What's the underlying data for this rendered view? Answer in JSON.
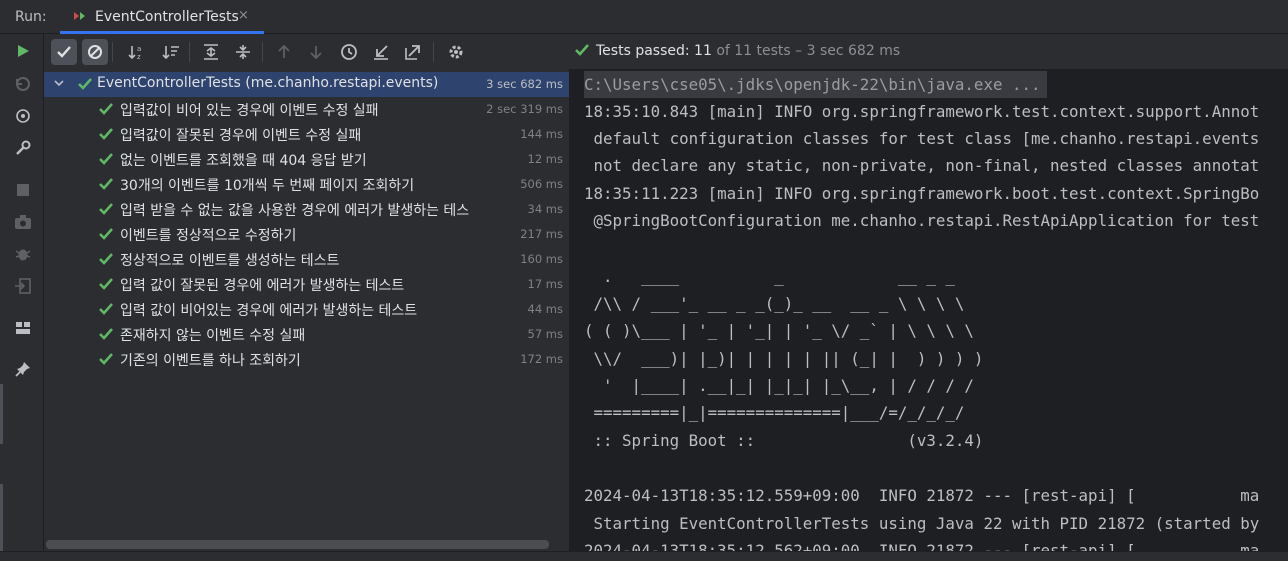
{
  "run_panel": {
    "label": "Run:",
    "tab_title": "EventControllerTests",
    "tab_close": "×"
  },
  "status": {
    "prefix": "Tests passed: ",
    "passed": "11",
    "suffix": " of 11 tests – 3 sec 682 ms"
  },
  "tree": {
    "root": {
      "name": "EventControllerTests (me.chanho.restapi.events)",
      "time": "3 sec 682 ms"
    },
    "tests": [
      {
        "name": "입력값이 비어 있는 경우에 이벤트 수정 실패",
        "time": "2 sec 319 ms"
      },
      {
        "name": "입력값이 잘못된 경우에 이벤트 수정 실패",
        "time": "144 ms"
      },
      {
        "name": "없는 이벤트를 조회했을 때 404 응답 받기",
        "time": "12 ms"
      },
      {
        "name": "30개의 이벤트를 10개씩 두 번째 페이지 조회하기",
        "time": "506 ms"
      },
      {
        "name": "입력 받을 수 없는 값을 사용한 경우에 에러가 발생하는 테스",
        "time": "34 ms"
      },
      {
        "name": "이벤트를 정상적으로 수정하기",
        "time": "217 ms"
      },
      {
        "name": "정상적으로 이벤트를 생성하는 테스트",
        "time": "160 ms"
      },
      {
        "name": "입력 값이 잘못된 경우에 에러가 발생하는 테스트",
        "time": "17 ms"
      },
      {
        "name": "입력 값이 비어있는 경우에 에러가 발생하는 테스트",
        "time": "44 ms"
      },
      {
        "name": "존재하지 않는 이벤트 수정 실패",
        "time": "57 ms"
      },
      {
        "name": "기존의 이벤트를 하나 조회하기",
        "time": "172 ms"
      }
    ]
  },
  "console": {
    "lines": [
      "C:\\Users\\cse05\\.jdks\\openjdk-22\\bin\\java.exe ...",
      "18:35:10.843 [main] INFO org.springframework.test.context.support.Annot",
      " default configuration classes for test class [me.chanho.restapi.events",
      " not declare any static, non-private, non-final, nested classes annotat",
      "18:35:11.223 [main] INFO org.springframework.boot.test.context.SpringBo",
      " @SpringBootConfiguration me.chanho.restapi.RestApiApplication for test",
      "",
      "  .   ____          _            __ _ _",
      " /\\\\ / ___'_ __ _ _(_)_ __  __ _ \\ \\ \\ \\",
      "( ( )\\___ | '_ | '_| | '_ \\/ _` | \\ \\ \\ \\",
      " \\\\/  ___)| |_)| | | | | || (_| |  ) ) ) )",
      "  '  |____| .__|_| |_|_| |_\\__, | / / / /",
      " =========|_|==============|___/=/_/_/_/",
      " :: Spring Boot ::                (v3.2.4)",
      "",
      "2024-04-13T18:35:12.559+09:00  INFO 21872 --- [rest-api] [           ma",
      " Starting EventControllerTests using Java 22 with PID 21872 (started by",
      "2024-04-13T18:35:12.562+09:00  INFO 21872 --- [rest-api] [           ma"
    ]
  },
  "colors": {
    "accent": "#3574f0",
    "pass_green": "#5fb865",
    "run_green": "#5fb865",
    "selection": "#2e436e"
  }
}
